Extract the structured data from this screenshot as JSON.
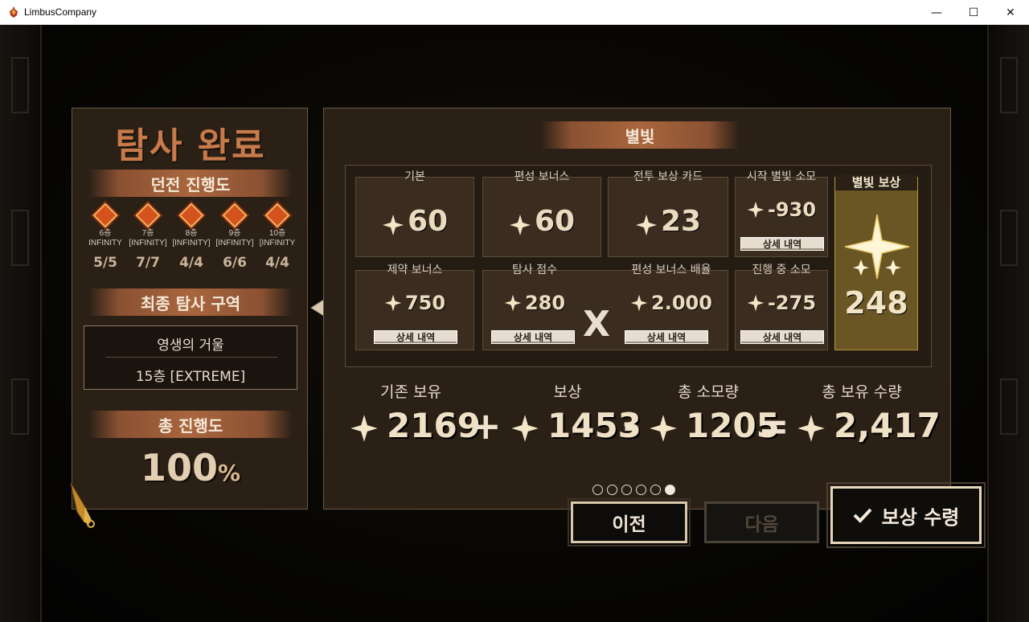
{
  "window": {
    "title": "LimbusCompany",
    "minimize_glyph": "—",
    "maximize_glyph": "☐",
    "close_glyph": "✕"
  },
  "left": {
    "title": "탐사 완료",
    "dungeon_progress_label": "던전 진행도",
    "floors": [
      {
        "label_line1": "6층",
        "label_line2": "INFINITY",
        "count": "5/5"
      },
      {
        "label_line1": "7층",
        "label_line2": "[INFINITY]",
        "count": "7/7"
      },
      {
        "label_line1": "8층",
        "label_line2": "[INFINITY]",
        "count": "4/4"
      },
      {
        "label_line1": "9층",
        "label_line2": "[INFINITY]",
        "count": "6/6"
      },
      {
        "label_line1": "10층",
        "label_line2": "[INFINITY",
        "count": "4/4"
      }
    ],
    "final_zone_label": "최종 탐사 구역",
    "zone_name": "영생의 거울",
    "zone_floor": "15층 [EXTREME]",
    "total_progress_label": "총 진행도",
    "total_progress_value": "100",
    "total_progress_unit": "%"
  },
  "right": {
    "banner": "별빛",
    "cells": {
      "base": {
        "label": "기본",
        "value": "60"
      },
      "formation_bonus": {
        "label": "편성 보너스",
        "value": "60"
      },
      "battle_reward_card": {
        "label": "전투 보상 카드",
        "value": "23"
      },
      "start_consumption": {
        "label": "시작 별빛 소모",
        "value": "-930",
        "detail": "상세 내역"
      },
      "restriction_bonus": {
        "label": "제약 보너스",
        "value": "750",
        "detail": "상세 내역"
      },
      "exploration_score": {
        "label": "탐사 점수",
        "value": "280",
        "detail": "상세 내역"
      },
      "multiply_symbol": "X",
      "formation_multiplier": {
        "label": "편성 보너스 배율",
        "value": "2.000",
        "detail": "상세 내역"
      },
      "in_progress_consumption": {
        "label": "진행 중 소모",
        "value": "-275",
        "detail": "상세 내역"
      },
      "starlight_reward": {
        "label": "별빛 보상",
        "value": "248"
      }
    },
    "summary": {
      "existing_label": "기존 보유",
      "existing_value": "2169",
      "plus": "+",
      "reward_label": "보상",
      "reward_value": "1453",
      "minus": "-",
      "consumed_label": "총 소모량",
      "consumed_value": "1205",
      "equals": "=",
      "total_label": "총 보유 수량",
      "total_value": "2,417"
    }
  },
  "pagination": {
    "total": 6,
    "active_index": 5
  },
  "buttons": {
    "prev": "이전",
    "next": "다음",
    "claim": "보상 수령"
  },
  "colors": {
    "panel_bg": "#2a2016",
    "accent_orange": "#c77a4a",
    "banner": "#a9663e",
    "reward_gold": "#6a5524"
  }
}
